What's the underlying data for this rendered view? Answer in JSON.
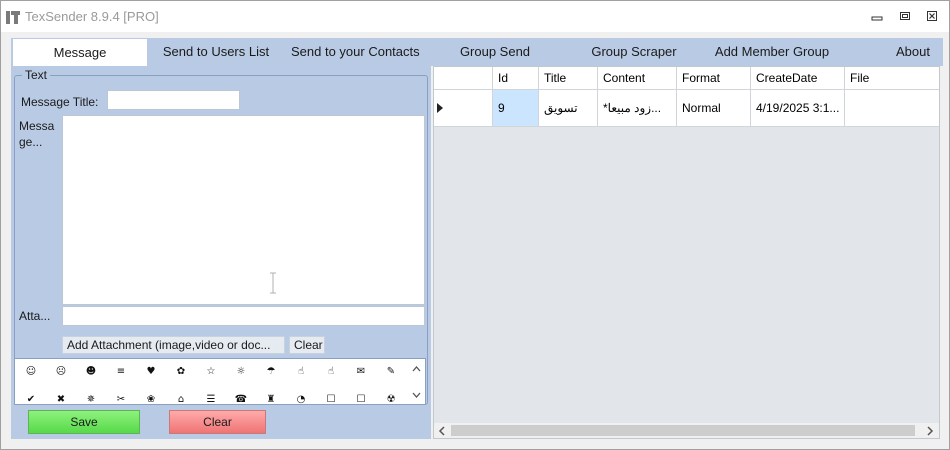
{
  "window": {
    "title": "TexSender 8.9.4 [PRO]"
  },
  "tabs": [
    {
      "label": "Message",
      "active": true
    },
    {
      "label": "Send to Users List"
    },
    {
      "label": "Send to your Contacts"
    },
    {
      "label": "Group Send"
    },
    {
      "label": "Group Scraper"
    },
    {
      "label": "Add Member Group"
    },
    {
      "label": "About"
    }
  ],
  "message_panel": {
    "group_label": "Text",
    "message_title_label": "Message Title:",
    "message_title_value": "",
    "message_label": "Message...",
    "message_value": "",
    "attachment_label": "Atta...",
    "attachment_value": "",
    "add_attachment_label": "Add  Attachment  (image,video  or doc...",
    "clear_attachment_label": "Clear",
    "emoji_row1": [
      "☺",
      "☹",
      "☻",
      "≡",
      "♥",
      "✿",
      "☆",
      "☼",
      "☂",
      "☝",
      "☝",
      "✉",
      "✎"
    ],
    "emoji_row2": [
      "✔",
      "✖",
      "✵",
      "✂",
      "❀",
      "⌂",
      "☰",
      "☎",
      "♜",
      "◔",
      "☐",
      "☐",
      "☢"
    ],
    "save_label": "Save",
    "clear_label": "Clear"
  },
  "grid": {
    "columns": [
      "Id",
      "Title",
      "Content",
      "Format",
      "CreateDate",
      "File"
    ],
    "rows": [
      [
        "9",
        "تسويق",
        "*زود مبيعا...",
        "Normal",
        "4/19/2025 3:1...",
        ""
      ]
    ]
  },
  "colors": {
    "panel_bg": "#b9cbe4",
    "grid_bg": "#e2e6ea",
    "save_green": "#57d94a",
    "clear_red": "#ef7474",
    "selected_cell": "#cce5ff"
  }
}
